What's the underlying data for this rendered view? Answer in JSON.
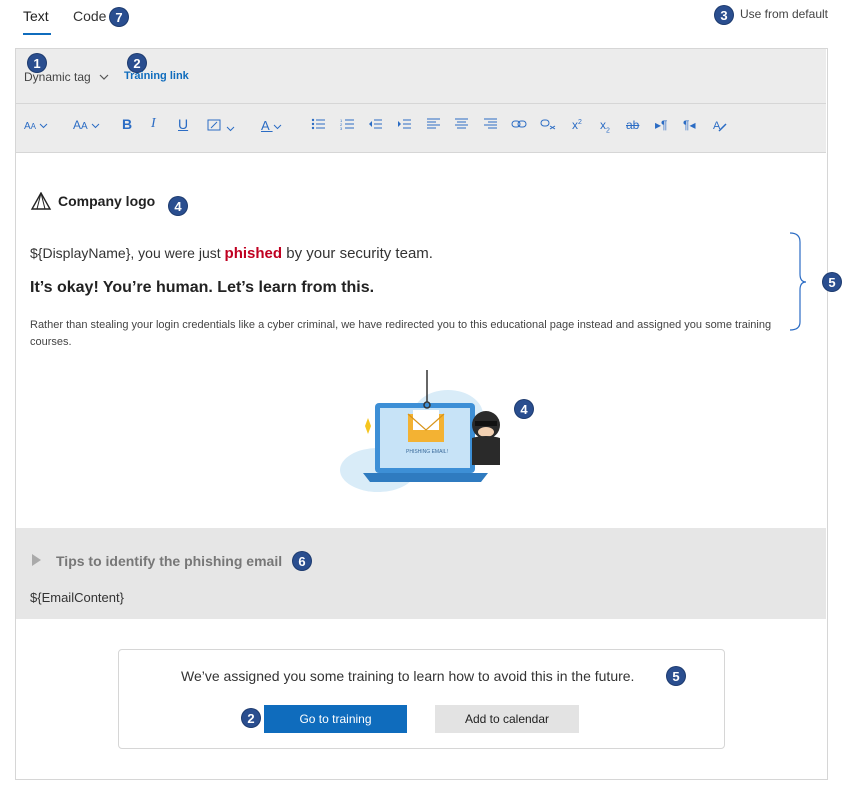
{
  "tabs": [
    {
      "label": "Text",
      "active": true
    },
    {
      "label": "Code",
      "active": false
    }
  ],
  "use_default_label": "Use from default",
  "insert_bar": {
    "dynamic_tag_label": "Dynamic tag",
    "training_link_label": "Training link"
  },
  "toolbar_icons": [
    "font-size-icon",
    "grow-font-icon",
    "bold-icon",
    "italic-icon",
    "underline-icon",
    "highlight-icon",
    "font-color-icon",
    "bullet-list-icon",
    "numbered-list-icon",
    "decrease-indent-icon",
    "increase-indent-icon",
    "align-left-icon",
    "align-center-icon",
    "align-right-icon",
    "link-icon",
    "unlink-icon",
    "superscript-icon",
    "subscript-icon",
    "strikethrough-icon",
    "ltr-icon",
    "rtl-icon",
    "clear-format-icon"
  ],
  "content": {
    "logo_text": "Company logo",
    "greeting_prefix": "${DisplayName}, you were just ",
    "greeting_highlight": "phished",
    "greeting_suffix": " by your security team.",
    "headline": "It’s okay! You’re human. Let’s learn from this.",
    "paragraph": "Rather than stealing your login credentials like a cyber criminal, we have redirected you to this educational page instead and assigned you some training courses.",
    "illustration_caption": "PHISHING EMAIL!",
    "tips_title": "Tips to identify the phishing email",
    "email_content": "${EmailContent}",
    "card_text": "We’ve assigned you some training to learn how to avoid this in the future.",
    "go_training_label": "Go to training",
    "add_calendar_label": "Add to calendar"
  },
  "badges": {
    "dynamic_tag": "1",
    "training_link": "2",
    "use_default": "3",
    "logo": "4",
    "illustration": "4",
    "text_block": "5",
    "card_text": "5",
    "tips": "6",
    "code_tab": "7",
    "go_training": "2"
  },
  "colors": {
    "accent": "#0f6cbd",
    "badge": "#2a4e8f",
    "phished": "#c00021"
  }
}
